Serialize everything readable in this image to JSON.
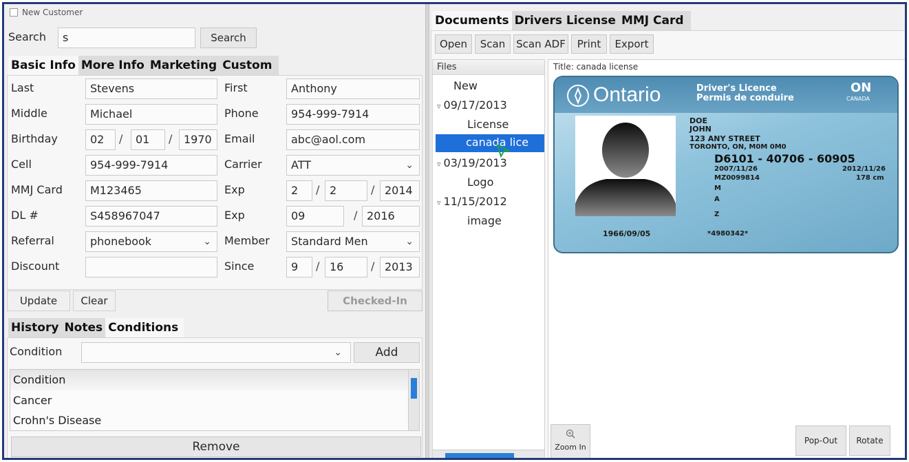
{
  "new_customer_label": "New Customer",
  "search": {
    "label": "Search",
    "value": "s",
    "button": "Search"
  },
  "info_tabs": [
    "Basic Info",
    "More Info",
    "Marketing",
    "Custom"
  ],
  "basic": {
    "last_label": "Last",
    "last": "Stevens",
    "first_label": "First",
    "first": "Anthony",
    "middle_label": "Middle",
    "middle": "Michael",
    "phone_label": "Phone",
    "phone": "954-999-7914",
    "birthday_label": "Birthday",
    "bday_m": "02",
    "bday_d": "01",
    "bday_y": "1970",
    "email_label": "Email",
    "email": "abc@aol.com",
    "cell_label": "Cell",
    "cell": "954-999-7914",
    "carrier_label": "Carrier",
    "carrier": "ATT",
    "mmj_label": "MMJ Card",
    "mmj": "M123465",
    "exp_label": "Exp",
    "mmj_exp_m": "2",
    "mmj_exp_d": "2",
    "mmj_exp_y": "2014",
    "dl_label": "DL #",
    "dl": "S458967047",
    "dl_exp_m": "09",
    "dl_exp_y": "2016",
    "referral_label": "Referral",
    "referral": "phonebook",
    "member_label": "Member",
    "member": "Standard Men",
    "discount_label": "Discount",
    "discount": "",
    "since_label": "Since",
    "since_m": "9",
    "since_d": "16",
    "since_y": "2013",
    "date_sep": "/"
  },
  "actions": {
    "update": "Update",
    "clear": "Clear",
    "checked_in": "Checked-In"
  },
  "lower_tabs": [
    "History",
    "Notes",
    "Conditions"
  ],
  "conditions": {
    "label": "Condition",
    "add": "Add",
    "header": "Condition",
    "items": [
      "Cancer",
      "Crohn's Disease"
    ],
    "remove": "Remove"
  },
  "doc_tabs": [
    "Documents",
    "Drivers License",
    "MMJ Card"
  ],
  "doc_toolbar": [
    "Open",
    "Scan",
    "Scan ADF",
    "Print",
    "Export"
  ],
  "files": {
    "header": "Files",
    "new": "New",
    "groups": [
      {
        "date": "09/17/2013",
        "children": [
          "License",
          "canada lice"
        ]
      },
      {
        "date": "03/19/2013",
        "children": [
          "Logo"
        ]
      },
      {
        "date": "11/15/2012",
        "children": [
          "image"
        ]
      }
    ]
  },
  "viewer": {
    "title": "Title: canada license",
    "zoom_in": "Zoom In",
    "pop_out": "Pop-Out",
    "rotate": "Rotate"
  },
  "license_card": {
    "province": "Ontario",
    "title_en": "Driver's Licence",
    "title_fr": "Permis de conduire",
    "region": "ON",
    "country": "CANADA",
    "surname": "DOE",
    "given": "JOHN",
    "street": "123 ANY STREET",
    "city": "TORONTO, ON, M0M 0M0",
    "number": "D6101 - 40706 - 60905",
    "issued": "2007/11/26",
    "expiry": "2012/11/26",
    "reference": "MZ0099814",
    "height": "178 cm",
    "sex": "M",
    "class": "A",
    "restrictions": "Z",
    "dob": "1966/09/05",
    "code": "*4980342*"
  },
  "colors": {
    "frame": "#223a78",
    "selection": "#1e6fd9",
    "card": "#8fc3dc"
  }
}
